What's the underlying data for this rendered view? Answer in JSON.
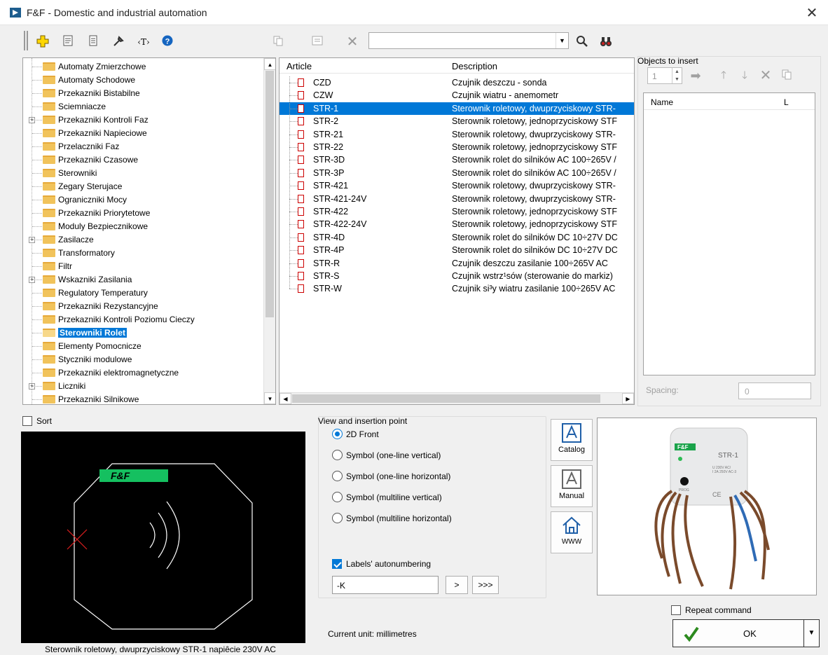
{
  "window": {
    "title": "F&F - Domestic and industrial automation",
    "close_label": "✕"
  },
  "toolbar": {
    "search_value": ""
  },
  "tree": {
    "items": [
      {
        "label": "Automaty Zmierzchowe",
        "expandable": false,
        "selected": false
      },
      {
        "label": "Automaty Schodowe",
        "expandable": false,
        "selected": false
      },
      {
        "label": "Przekazniki Bistabilne",
        "expandable": false,
        "selected": false
      },
      {
        "label": "Sciemniacze",
        "expandable": false,
        "selected": false
      },
      {
        "label": "Przekazniki Kontroli Faz",
        "expandable": true,
        "selected": false
      },
      {
        "label": "Przekazniki Napieciowe",
        "expandable": false,
        "selected": false
      },
      {
        "label": "Przelaczniki Faz",
        "expandable": false,
        "selected": false
      },
      {
        "label": "Przekazniki Czasowe",
        "expandable": false,
        "selected": false
      },
      {
        "label": "Sterowniki",
        "expandable": false,
        "selected": false
      },
      {
        "label": "Zegary Sterujace",
        "expandable": false,
        "selected": false
      },
      {
        "label": "Ograniczniki Mocy",
        "expandable": false,
        "selected": false
      },
      {
        "label": "Przekazniki Priorytetowe",
        "expandable": false,
        "selected": false
      },
      {
        "label": "Moduly Bezpiecznikowe",
        "expandable": false,
        "selected": false
      },
      {
        "label": "Zasilacze",
        "expandable": true,
        "selected": false
      },
      {
        "label": "Transformatory",
        "expandable": false,
        "selected": false
      },
      {
        "label": "Filtr",
        "expandable": false,
        "selected": false
      },
      {
        "label": "Wskazniki Zasilania",
        "expandable": true,
        "selected": false
      },
      {
        "label": "Regulatory Temperatury",
        "expandable": false,
        "selected": false
      },
      {
        "label": "Przekazniki Rezystancyjne",
        "expandable": false,
        "selected": false
      },
      {
        "label": "Przekazniki Kontroli Poziomu Cieczy",
        "expandable": false,
        "selected": false
      },
      {
        "label": "Sterowniki Rolet",
        "expandable": false,
        "selected": true
      },
      {
        "label": "Elementy Pomocnicze",
        "expandable": false,
        "selected": false
      },
      {
        "label": "Styczniki modulowe",
        "expandable": false,
        "selected": false
      },
      {
        "label": "Przekazniki elektromagnetyczne",
        "expandable": false,
        "selected": false
      },
      {
        "label": "Liczniki",
        "expandable": true,
        "selected": false
      },
      {
        "label": "Przekazniki Silnikowe",
        "expandable": false,
        "selected": false
      }
    ]
  },
  "articles": {
    "header_article": "Article",
    "header_description": "Description",
    "rows": [
      {
        "code": "CZD",
        "description": "Czujnik deszczu - sonda",
        "selected": false
      },
      {
        "code": "CZW",
        "description": "Czujnik wiatru - anemometr",
        "selected": false
      },
      {
        "code": "STR-1",
        "description": "Sterownik roletowy, dwuprzyciskowy STR-",
        "selected": true
      },
      {
        "code": "STR-2",
        "description": "Sterownik roletowy, jednoprzyciskowy STF",
        "selected": false
      },
      {
        "code": "STR-21",
        "description": "Sterownik roletowy, dwuprzyciskowy STR-",
        "selected": false
      },
      {
        "code": "STR-22",
        "description": "Sterownik roletowy, jednoprzyciskowy STF",
        "selected": false
      },
      {
        "code": "STR-3D",
        "description": "Sterownik rolet do silników AC 100÷265V /",
        "selected": false
      },
      {
        "code": "STR-3P",
        "description": "Sterownik rolet do silników AC 100÷265V /",
        "selected": false
      },
      {
        "code": "STR-421",
        "description": "Sterownik roletowy, dwuprzyciskowy STR-",
        "selected": false
      },
      {
        "code": "STR-421-24V",
        "description": "Sterownik roletowy, dwuprzyciskowy STR-",
        "selected": false
      },
      {
        "code": "STR-422",
        "description": "Sterownik roletowy, jednoprzyciskowy STF",
        "selected": false
      },
      {
        "code": "STR-422-24V",
        "description": "Sterownik roletowy, jednoprzyciskowy STF",
        "selected": false
      },
      {
        "code": "STR-4D",
        "description": "Sterownik rolet do silników DC 10÷27V DC",
        "selected": false
      },
      {
        "code": "STR-4P",
        "description": "Sterownik rolet do silników DC 10÷27V DC",
        "selected": false
      },
      {
        "code": "STR-R",
        "description": "Czujnik deszczu zasilanie 100÷265V AC",
        "selected": false
      },
      {
        "code": "STR-S",
        "description": "Czujnik wstrz¹sów (sterowanie do markiz)",
        "selected": false
      },
      {
        "code": "STR-W",
        "description": "Czujnik si³y wiatru zasilanie 100÷265V AC",
        "selected": false
      }
    ]
  },
  "objects": {
    "legend": "Objects to insert",
    "count_value": "1",
    "col_name": "Name",
    "col_l": "L",
    "spacing_label": "Spacing:",
    "spacing_value": "0"
  },
  "sort_label": "Sort",
  "preview": {
    "logo_text": "F&F",
    "caption": "Sterownik roletowy, dwuprzyciskowy STR-1 napiêcie 230V AC"
  },
  "view": {
    "legend": "View and insertion point",
    "options": [
      {
        "label": "2D Front",
        "checked": true
      },
      {
        "label": "Symbol (one-line vertical)",
        "checked": false
      },
      {
        "label": "Symbol (one-line horizontal)",
        "checked": false
      },
      {
        "label": "Symbol (multiline vertical)",
        "checked": false
      },
      {
        "label": "Symbol (multiline horizontal)",
        "checked": false
      }
    ],
    "autonumber_label": "Labels' autonumbering",
    "label_prefix": "-K",
    "next_label": ">",
    "all_label": ">>>"
  },
  "side_buttons": {
    "catalog": "Catalog",
    "manual": "Manual",
    "www": "WWW"
  },
  "product_photo": {
    "brand": "F&F",
    "model": "STR-1",
    "spec_line1": "U 230V AC/",
    "spec_line2": "I 2A 250V AC-3",
    "prog": "PROG",
    "ce": "CE"
  },
  "current_unit": "Current unit: millimetres",
  "repeat_label": "Repeat command",
  "ok_label": "OK"
}
